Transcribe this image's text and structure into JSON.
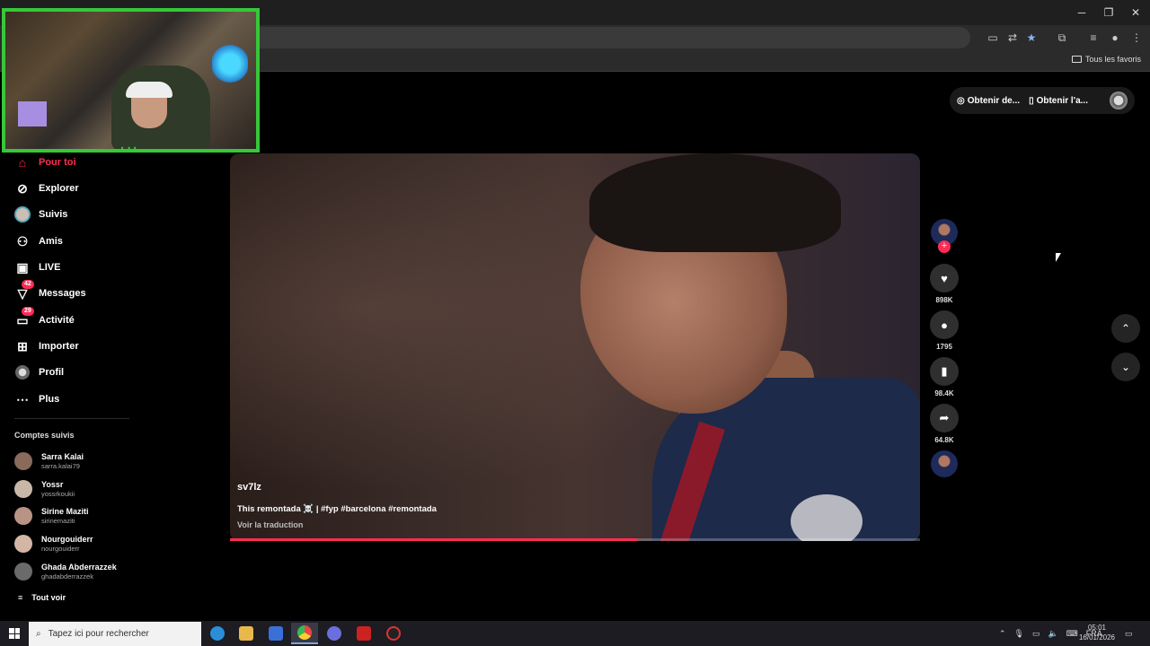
{
  "browser": {
    "window_controls": {
      "minimize": "─",
      "restore": "❐",
      "close": "✕"
    },
    "bookmarks_all": "Tous les favoris"
  },
  "header": {
    "get_coins_label": "Obtenir de...",
    "get_app_label": "Obtenir l'a..."
  },
  "nav": {
    "items": [
      {
        "label": "Pour toi",
        "icon": "home-icon",
        "active": true
      },
      {
        "label": "Explorer",
        "icon": "compass-icon"
      },
      {
        "label": "Suivis",
        "icon": "following-avatar-icon"
      },
      {
        "label": "Amis",
        "icon": "friends-icon"
      },
      {
        "label": "LIVE",
        "icon": "live-icon"
      },
      {
        "label": "Messages",
        "icon": "messages-icon",
        "badge": "42"
      },
      {
        "label": "Activité",
        "icon": "activity-icon",
        "badge": "29"
      },
      {
        "label": "Importer",
        "icon": "upload-icon"
      },
      {
        "label": "Profil",
        "icon": "profile-icon"
      },
      {
        "label": "Plus",
        "icon": "more-icon"
      }
    ]
  },
  "following": {
    "heading": "Comptes suivis",
    "accounts": [
      {
        "name": "Sarra Kalai",
        "username": "sarra.kalai79"
      },
      {
        "name": "Yossr",
        "username": "yossrkoukii"
      },
      {
        "name": "Sirine Maziti",
        "username": "sirinemaziti"
      },
      {
        "name": "Nourgouiderr",
        "username": "nourgouiderr"
      },
      {
        "name": "Ghada Abderrazzek",
        "username": "ghadabderrazzek"
      }
    ],
    "see_all": "Tout voir"
  },
  "video": {
    "author": "sv7lz",
    "caption": "This remontada ☠️ | #fyp #barcelona #remontada",
    "translate": "Voir la traduction",
    "progress": 0.59
  },
  "actions": {
    "likes": "898K",
    "comments": "1795",
    "saves": "98.4K",
    "shares": "64.8K"
  },
  "taskbar": {
    "search_placeholder": "Tapez ici pour rechercher",
    "language": "FRA",
    "time": "05:01",
    "date": "16/01/2026"
  },
  "colors": {
    "accent": "#fe2c55",
    "webcam_border": "#37c73a"
  }
}
